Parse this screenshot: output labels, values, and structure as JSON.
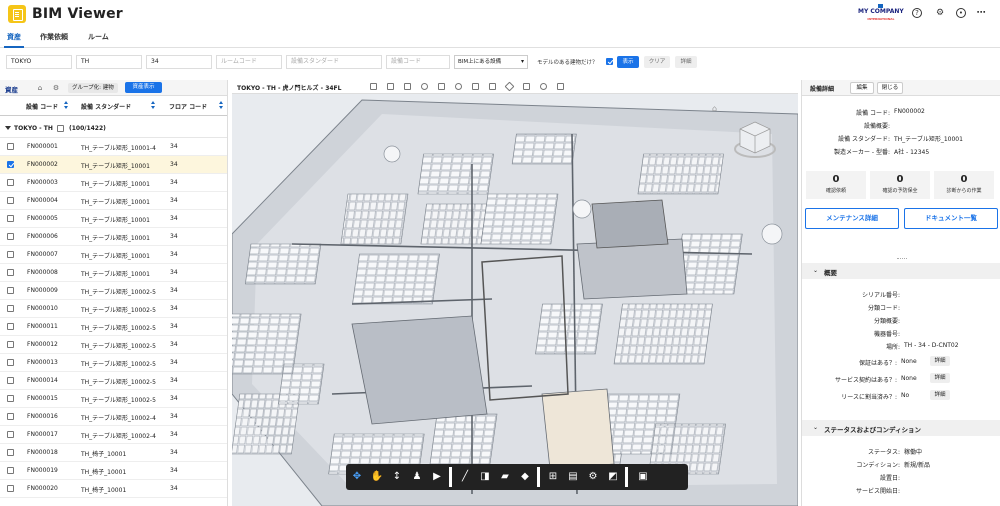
{
  "app": {
    "title": "BIM Viewer",
    "company": "MY COMPANY",
    "company_sub": "INTERNATIONAL"
  },
  "tabs": [
    {
      "label": "資産"
    },
    {
      "label": "作業依頼"
    },
    {
      "label": "ルーム"
    }
  ],
  "filters": {
    "site": "TOKYO",
    "building": "TH",
    "floor": "34",
    "room_placeholder": "ルームコード",
    "standard_placeholder": "設備スタンダード",
    "code_placeholder": "設備コード",
    "bim_select": "BIM上にある設備",
    "model_only_label": "モデルのある建物だけ？",
    "show_label": "表示",
    "clear_label": "クリア",
    "detail_label": "詳細"
  },
  "left": {
    "title": "資産",
    "group_label": "グループ化: 建物",
    "asset_button": "資産表示",
    "columns": [
      "設備 コード",
      "設備 スタンダード",
      "フロア コード"
    ],
    "group_row": {
      "label": "TOKYO - TH",
      "count": "(100/1422)"
    },
    "rows": [
      {
        "code": "FN000001",
        "standard": "TH_テーブル矩形_10001-4",
        "floor": "34",
        "checked": false
      },
      {
        "code": "FN000002",
        "standard": "TH_テーブル矩形_10001",
        "floor": "34",
        "checked": true
      },
      {
        "code": "FN000003",
        "standard": "TH_テーブル矩形_10001",
        "floor": "34",
        "checked": false
      },
      {
        "code": "FN000004",
        "standard": "TH_テーブル矩形_10001",
        "floor": "34",
        "checked": false
      },
      {
        "code": "FN000005",
        "standard": "TH_テーブル矩形_10001",
        "floor": "34",
        "checked": false
      },
      {
        "code": "FN000006",
        "standard": "TH_テーブル矩形_10001",
        "floor": "34",
        "checked": false
      },
      {
        "code": "FN000007",
        "standard": "TH_テーブル矩形_10001",
        "floor": "34",
        "checked": false
      },
      {
        "code": "FN000008",
        "standard": "TH_テーブル矩形_10001",
        "floor": "34",
        "checked": false
      },
      {
        "code": "FN000009",
        "standard": "TH_テーブル矩形_10002-5",
        "floor": "34",
        "checked": false
      },
      {
        "code": "FN000010",
        "standard": "TH_テーブル矩形_10002-5",
        "floor": "34",
        "checked": false
      },
      {
        "code": "FN000011",
        "standard": "TH_テーブル矩形_10002-5",
        "floor": "34",
        "checked": false
      },
      {
        "code": "FN000012",
        "standard": "TH_テーブル矩形_10002-5",
        "floor": "34",
        "checked": false
      },
      {
        "code": "FN000013",
        "standard": "TH_テーブル矩形_10002-5",
        "floor": "34",
        "checked": false
      },
      {
        "code": "FN000014",
        "standard": "TH_テーブル矩形_10002-5",
        "floor": "34",
        "checked": false
      },
      {
        "code": "FN000015",
        "standard": "TH_テーブル矩形_10002-5",
        "floor": "34",
        "checked": false
      },
      {
        "code": "FN000016",
        "standard": "TH_テーブル矩形_10002-4",
        "floor": "34",
        "checked": false
      },
      {
        "code": "FN000017",
        "standard": "TH_テーブル矩形_10002-4",
        "floor": "34",
        "checked": false
      },
      {
        "code": "FN000018",
        "standard": "TH_椅子_10001",
        "floor": "34",
        "checked": false
      },
      {
        "code": "FN000019",
        "standard": "TH_椅子_10001",
        "floor": "34",
        "checked": false
      },
      {
        "code": "FN000020",
        "standard": "TH_椅子_10001",
        "floor": "34",
        "checked": false
      }
    ]
  },
  "viewer": {
    "title": "TOKYO - TH - 虎ノ門ヒルズ - 34FL"
  },
  "right": {
    "title": "設備詳細",
    "edit_label": "編集",
    "close_label": "閉じる",
    "details": [
      {
        "k": "設備 コード:",
        "v": "FN000002"
      },
      {
        "k": "設備概要:",
        "v": ""
      },
      {
        "k": "設備 スタンダード:",
        "v": "TH_テーブル矩形_10001"
      },
      {
        "k": "製造メーカー - 型番:",
        "v": "A社 - 12345"
      }
    ],
    "stats": [
      {
        "n": "0",
        "l": "確認依頼"
      },
      {
        "n": "0",
        "l": "確認の予防保全"
      },
      {
        "n": "0",
        "l": "診断からの作業"
      }
    ],
    "maint_button": "メンテナンス詳細",
    "doc_button": "ドキュメント一覧",
    "summary_title": "概要",
    "summary": [
      {
        "k": "シリアル番号:",
        "v": ""
      },
      {
        "k": "分類コード:",
        "v": ""
      },
      {
        "k": "分類概要:",
        "v": ""
      },
      {
        "k": "機器番号:",
        "v": ""
      },
      {
        "k": "場所:",
        "v": "TH - 34 - D-CNT02"
      }
    ],
    "warranty": [
      {
        "k": "保証はある？:",
        "v": "None",
        "btn": "詳細"
      },
      {
        "k": "サービス契約はある？:",
        "v": "None",
        "btn": "詳細"
      },
      {
        "k": "リースに割当済み？:",
        "v": "No",
        "btn": "詳細"
      }
    ],
    "status_title": "ステータスおよびコンディション",
    "status": [
      {
        "k": "ステータス:",
        "v": "稼働中"
      },
      {
        "k": "コンディション:",
        "v": "新規/新品"
      },
      {
        "k": "設置日:",
        "v": ""
      },
      {
        "k": "サービス開始日:",
        "v": ""
      }
    ]
  }
}
